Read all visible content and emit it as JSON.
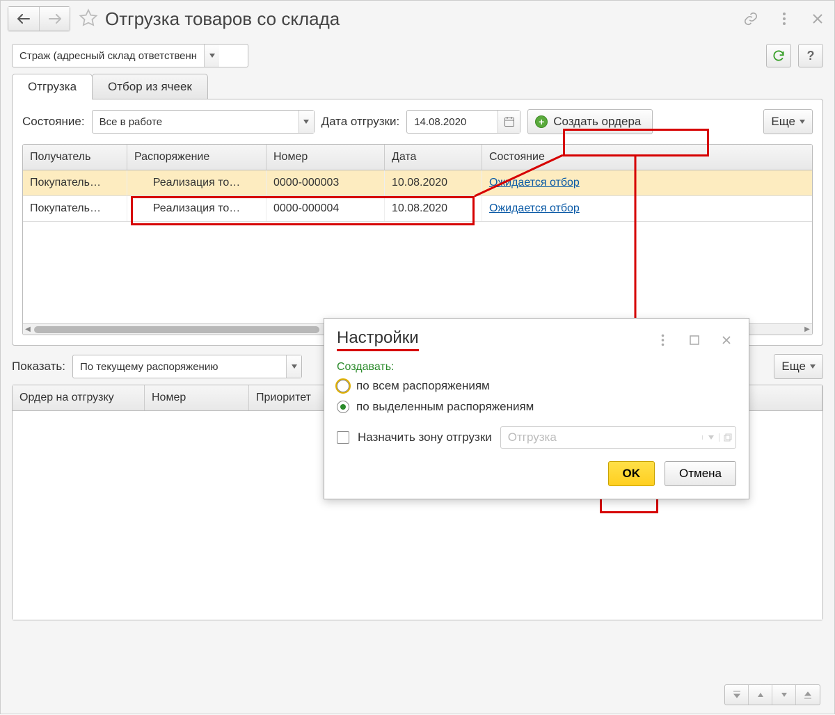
{
  "header": {
    "title": "Отгрузка товаров со склада"
  },
  "toolbar": {
    "warehouse": "Страж (адресный склад ответственн",
    "help": "?"
  },
  "tabs": [
    {
      "label": "Отгрузка",
      "active": true
    },
    {
      "label": "Отбор из ячеек",
      "active": false
    }
  ],
  "filters": {
    "status_label": "Состояние:",
    "status_value": "Все в работе",
    "date_label": "Дата отгрузки:",
    "date_value": "14.08.2020",
    "create_orders": "Создать ордера",
    "more": "Еще"
  },
  "columns": {
    "recipient": "Получатель",
    "order": "Распоряжение",
    "number": "Номер",
    "date": "Дата",
    "status": "Состояние"
  },
  "rows": [
    {
      "recipient": "Покупатель…",
      "order": "Реализация то…",
      "number": "0000-000003",
      "date": "10.08.2020",
      "status": "Ожидается отбор",
      "selected": true
    },
    {
      "recipient": "Покупатель…",
      "order": "Реализация то…",
      "number": "0000-000004",
      "date": "10.08.2020",
      "status": "Ожидается отбор",
      "selected": false
    }
  ],
  "lower": {
    "show_label": "Показать:",
    "show_value": "По текущему распоряжению",
    "more": "Еще",
    "cols": {
      "order": "Ордер на отгрузку",
      "number": "Номер",
      "priority": "Приоритет"
    }
  },
  "dialog": {
    "title": "Настройки",
    "create_label": "Создавать:",
    "opt_all": "по всем распоряжениям",
    "opt_selected": "по выделенным распоряжениям",
    "assign_zone": "Назначить зону отгрузки",
    "zone_placeholder": "Отгрузка",
    "ok": "OK",
    "cancel": "Отмена"
  }
}
